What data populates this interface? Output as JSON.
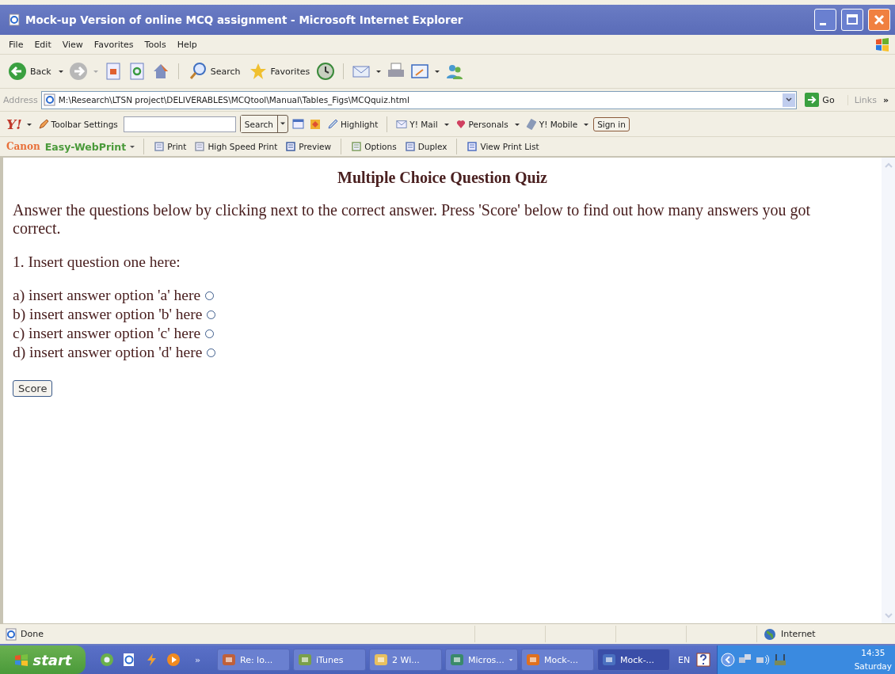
{
  "window": {
    "title": "Mock-up Version of online MCQ assignment - Microsoft Internet Explorer"
  },
  "menu": [
    "File",
    "Edit",
    "View",
    "Favorites",
    "Tools",
    "Help"
  ],
  "toolbar": {
    "back": "Back",
    "search": "Search",
    "favorites": "Favorites"
  },
  "address": {
    "label": "Address",
    "value": "M:\\Research\\LTSN project\\DELIVERABLES\\MCQtool\\Manual\\Tables_Figs\\MCQquiz.html",
    "go": "Go",
    "links": "Links",
    "more": "»"
  },
  "yahoo": {
    "logo": "Y!",
    "settings": "Toolbar Settings",
    "search": "Search",
    "highlight": "Highlight",
    "mail": "Y! Mail",
    "personals": "Personals",
    "mobile": "Y! Mobile",
    "signin": "Sign in"
  },
  "canon": {
    "brand": "Canon",
    "product": "Easy-WebPrint",
    "items": [
      "Print",
      "High Speed Print",
      "Preview",
      "Options",
      "Duplex",
      "View Print List"
    ]
  },
  "page": {
    "heading": "Multiple Choice Question Quiz",
    "intro": "Answer the questions below by clicking next to the correct answer. Press 'Score' below to find out how many answers you got correct.",
    "question": "1. Insert question one here:",
    "options": [
      {
        "label": "a) insert answer option 'a' here",
        "selected": false
      },
      {
        "label": "b) insert answer option 'b' here",
        "selected": false
      },
      {
        "label": "c) insert answer option 'c' here",
        "selected": false
      },
      {
        "label": "d) insert answer option 'd' here",
        "selected": false
      }
    ],
    "button": "Score"
  },
  "status_bar": {
    "text": "Done",
    "zone": "Internet"
  },
  "taskbar": {
    "start": "start",
    "more": "»",
    "tasks": [
      {
        "label": "Re: lo...",
        "selected": false
      },
      {
        "label": "iTunes",
        "selected": false
      },
      {
        "label": "2 Wi...",
        "selected": false
      },
      {
        "label": "Micros...",
        "selected": false
      },
      {
        "label": "Mock-...",
        "selected": false
      },
      {
        "label": "Mock-...",
        "selected": true
      }
    ],
    "language": "EN",
    "time": "14:35",
    "day": "Saturday"
  }
}
